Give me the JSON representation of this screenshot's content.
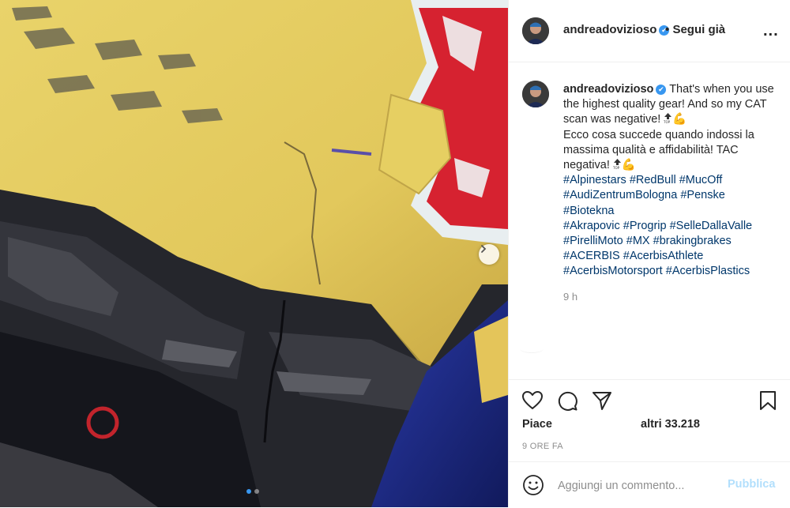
{
  "colors": {
    "accent": "#3897f0",
    "hashtag": "#00376b",
    "muted": "#8e8e8e",
    "publish_disabled": "#b2dffc"
  },
  "media": {
    "image_alt": "Casco giallo Red Bull con visiera rotta",
    "carousel_count": 2,
    "carousel_active": 0,
    "next_icon": "chevron-right-icon"
  },
  "header": {
    "username": "andreadovizioso",
    "verified_icon": "verified-badge-icon",
    "separator": "•",
    "follow_label": "Segui già",
    "more_icon": "more-options-icon",
    "more_label": "..."
  },
  "caption": {
    "username": "andreadovizioso",
    "line1": "That's when you use the highest quality gear! And so my CAT scan was negative!",
    "line2": "Ecco cosa succede quando indossi la massima qualità e affidabilità! TAC negativa!",
    "emoji": "💪",
    "hashtags": [
      [
        "#Alpinestars",
        "#RedBull",
        "#MucOff"
      ],
      [
        "#AudiZentrumBologna",
        "#Penske"
      ],
      [
        "#Biotekna"
      ],
      [
        "#Akrapovic",
        "#Progrip",
        "#SelleDallaValle"
      ],
      [
        "#PirelliMoto",
        "#MX",
        "#brakingbrakes"
      ],
      [
        "#ACERBIS",
        "#AcerbisAthlete"
      ],
      [
        "#AcerbisMotorsport",
        "#AcerbisPlastics"
      ]
    ],
    "time": "9 h"
  },
  "actions": {
    "icons": [
      "heart-icon",
      "comment-icon",
      "share-icon",
      "save-icon"
    ],
    "likes_prefix": "Piace",
    "likes_suffix": "altri 33.218",
    "date": "9 ORE FA"
  },
  "comment_box": {
    "placeholder": "Aggiungi un commento...",
    "publish_label": "Pubblica",
    "emoji_icon": "smiley-icon"
  }
}
